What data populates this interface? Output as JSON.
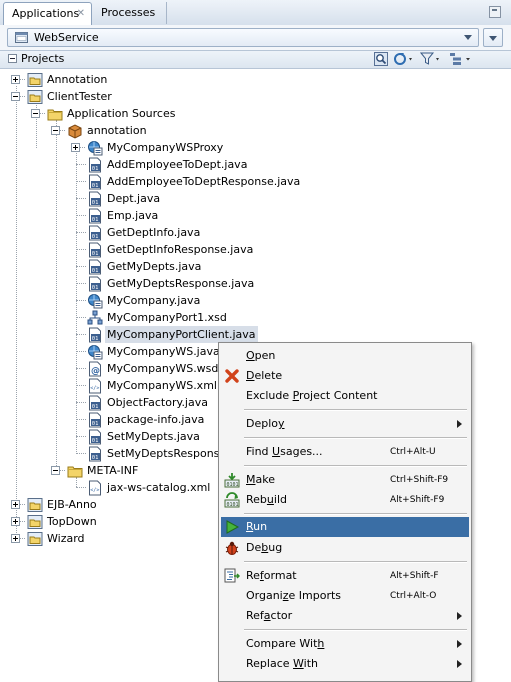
{
  "tabs": [
    {
      "label": "Applications",
      "active": true,
      "close": "✕"
    },
    {
      "label": "Processes",
      "active": false
    }
  ],
  "application_selector": {
    "value": "WebService"
  },
  "projects_panel": {
    "title": "Projects"
  },
  "tree": {
    "annotation": "Annotation",
    "clienttester": "ClientTester",
    "application_sources": "Application Sources",
    "package_annotation": "annotation",
    "files": [
      "MyCompanyWSProxy",
      "AddEmployeeToDept.java",
      "AddEmployeeToDeptResponse.java",
      "Dept.java",
      "Emp.java",
      "GetDeptInfo.java",
      "GetDeptInfoResponse.java",
      "GetMyDepts.java",
      "GetMyDeptsResponse.java",
      "MyCompany.java",
      "MyCompanyPort1.xsd",
      "MyCompanyPortClient.java",
      "MyCompanyWS.java",
      "MyCompanyWS.wsdl",
      "MyCompanyWS.xml",
      "ObjectFactory.java",
      "package-info.java",
      "SetMyDepts.java",
      "SetMyDeptsResponse.java"
    ],
    "meta_inf": "META-INF",
    "jax_ws_catalog": "jax-ws-catalog.xml",
    "ejb_anno": "EJB-Anno",
    "topdown": "TopDown",
    "wizard": "Wizard"
  },
  "context_menu": {
    "open": {
      "pre": "",
      "u": "O",
      "post": "pen"
    },
    "delete": {
      "pre": "",
      "u": "D",
      "post": "elete"
    },
    "exclude": {
      "pre": "Exclude ",
      "u": "P",
      "post": "roject Content"
    },
    "deploy": {
      "pre": "Deplo",
      "u": "y",
      "post": ""
    },
    "find_usages": {
      "pre": "Find ",
      "u": "U",
      "post": "sages...",
      "shortcut": "Ctrl+Alt-U"
    },
    "make": {
      "pre": "",
      "u": "M",
      "post": "ake",
      "shortcut": "Ctrl+Shift-F9"
    },
    "rebuild": {
      "pre": "Reb",
      "u": "u",
      "post": "ild",
      "shortcut": "Alt+Shift-F9"
    },
    "run": {
      "pre": "",
      "u": "R",
      "post": "un"
    },
    "debug": {
      "pre": "De",
      "u": "b",
      "post": "ug"
    },
    "reformat": {
      "pre": "Re",
      "u": "f",
      "post": "ormat",
      "shortcut": "Alt+Shift-F"
    },
    "organize_imports": {
      "pre": "Organi",
      "u": "z",
      "post": "e Imports",
      "shortcut": "Ctrl+Alt-O"
    },
    "refactor": {
      "pre": "Ref",
      "u": "a",
      "post": "ctor"
    },
    "compare_with": {
      "pre": "Compare Wit",
      "u": "h",
      "post": ""
    },
    "replace_with": {
      "pre": "Replace ",
      "u": "W",
      "post": "ith"
    }
  }
}
